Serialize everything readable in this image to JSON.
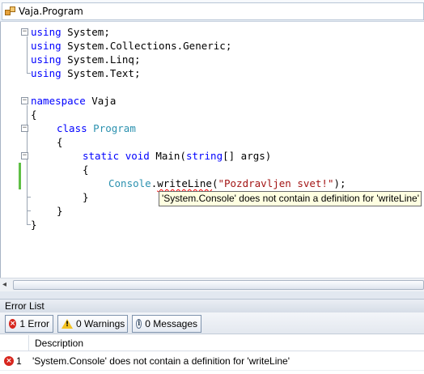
{
  "navbar": {
    "class_icon": "class-icon",
    "selected_class": "Vaja.Program"
  },
  "editor": {
    "lines": [
      {
        "p1": "using",
        "p2": " System;"
      },
      {
        "p1": "using",
        "p2": " System.Collections.Generic;"
      },
      {
        "p1": "using",
        "p2": " System.Linq;"
      },
      {
        "p1": "using",
        "p2": " System.Text;"
      },
      {
        "p1": "namespace",
        "p2": " Vaja"
      },
      {
        "p1": "{"
      },
      {
        "p1": "class",
        "p2": "Program"
      },
      {
        "p1": "{"
      },
      {
        "p1": "static",
        "p2": "void",
        "p3": " Main(",
        "p4": "string",
        "p5": "[] args)"
      },
      {
        "p1": "{"
      },
      {
        "p1": "Console",
        "p2": ".",
        "p3": "writeLine",
        "p4": "(",
        "p5": "\"Pozdravljen svet!\"",
        "p6": ");"
      },
      {
        "p1": "}"
      },
      {
        "p1": "}"
      },
      {
        "p1": "}"
      }
    ],
    "tooltip": "'System.Console' does not contain a definition for 'writeLine'"
  },
  "error_list": {
    "title": "Error List",
    "filters": {
      "errors": "1 Error",
      "warnings": "0 Warnings",
      "messages": "0 Messages"
    },
    "columns": {
      "description": "Description"
    },
    "rows": [
      {
        "num": "1",
        "description": "'System.Console' does not contain a definition for 'writeLine'"
      }
    ]
  },
  "colors": {
    "keyword": "#0000ff",
    "type": "#2b91af",
    "string": "#a31515",
    "error": "#d7261e",
    "tooltip_bg": "#ffffe1",
    "change_bar": "#5fbf45"
  }
}
